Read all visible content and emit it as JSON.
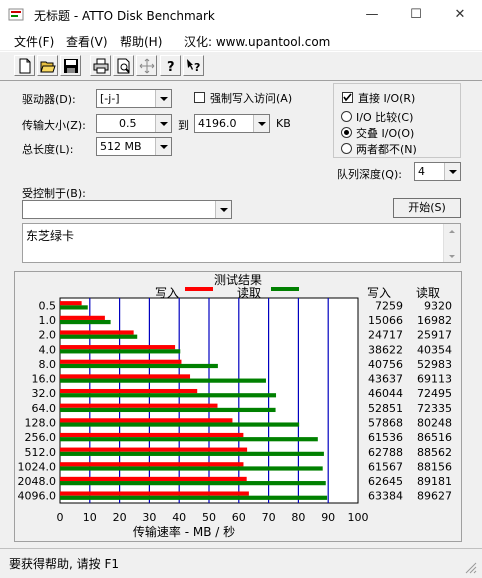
{
  "window": {
    "title": "无标题 - ATTO Disk Benchmark",
    "minimize": "—",
    "maximize": "☐",
    "close": "✕"
  },
  "menu": {
    "items": [
      {
        "label": "文件(F)"
      },
      {
        "label": "查看(V)"
      },
      {
        "label": "帮助(H)"
      },
      {
        "label": "汉化: www.upantool.com"
      }
    ]
  },
  "toolbar": {
    "icons": [
      "new-icon",
      "open-icon",
      "save-icon",
      "print-icon",
      "print-preview-icon",
      "move-icon",
      "help-icon",
      "context-help-icon"
    ]
  },
  "form": {
    "drive_label": "驱动器(D):",
    "drive_value": "[-j-]",
    "force_write_label": "强制写入访问(A)",
    "force_write_checked": false,
    "transfer_label": "传输大小(Z):",
    "transfer_from": "0.5",
    "to_label": "到",
    "transfer_to": "4196.0",
    "kb_label": "KB",
    "total_label": "总长度(L):",
    "total_value": "512 MB",
    "direct_io_label": "直接 I/O(R)",
    "direct_io_checked": true,
    "io_options": [
      {
        "label": "I/O 比较(C)",
        "selected": false
      },
      {
        "label": "交叠 I/O(O)",
        "selected": true
      },
      {
        "label": "两者都不(N)",
        "selected": false
      }
    ],
    "queue_label": "队列深度(Q):",
    "queue_value": "4",
    "controlled_label": "受控制于(B):",
    "controlled_value": "",
    "start_button": "开始(S)",
    "description": "东芝绿卡"
  },
  "chart_data": {
    "type": "bar",
    "title": "测试结果",
    "legend": [
      {
        "name": "写入",
        "color": "#ff0000"
      },
      {
        "name": "读取",
        "color": "#008000"
      }
    ],
    "categories": [
      "0.5",
      "1.0",
      "2.0",
      "4.0",
      "8.0",
      "16.0",
      "32.0",
      "64.0",
      "128.0",
      "256.0",
      "512.0",
      "1024.0",
      "2048.0",
      "4096.0"
    ],
    "series": [
      {
        "name": "写入",
        "values": [
          7259,
          15066,
          24717,
          38622,
          40756,
          43637,
          46044,
          52851,
          57868,
          61536,
          62788,
          61567,
          62645,
          63384
        ]
      },
      {
        "name": "读取",
        "values": [
          9320,
          16982,
          25917,
          40354,
          52983,
          69113,
          72495,
          72335,
          80248,
          86516,
          88562,
          88156,
          89181,
          89627
        ]
      }
    ],
    "write_header": "写入",
    "read_header": "读取",
    "xlabel": "传输速率 - MB / 秒",
    "xticks": [
      "0",
      "10",
      "20",
      "30",
      "40",
      "50",
      "60",
      "70",
      "80",
      "90",
      "100"
    ],
    "xlim": [
      0,
      100
    ],
    "grid": true,
    "orientation": "horizontal"
  },
  "status": {
    "text": "要获得帮助, 请按 F1"
  },
  "colors": {
    "write": "#ff0000",
    "read": "#008000",
    "grid": "#0000c0"
  }
}
